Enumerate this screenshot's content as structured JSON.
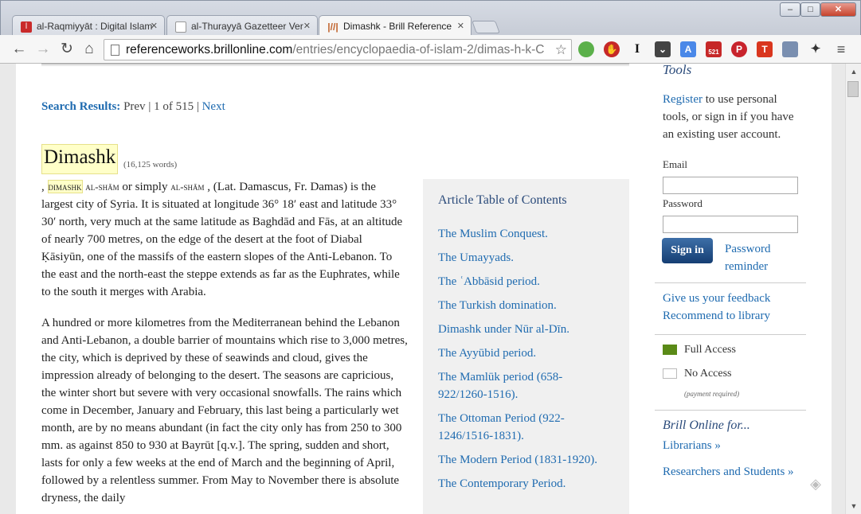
{
  "browser": {
    "tabs": [
      {
        "label": "al-Raqmiyyāt : Digital Islam",
        "icon": "al-raqmiyyat-icon"
      },
      {
        "label": "al-Thurayyā Gazetteer Ver",
        "icon": "page-icon"
      },
      {
        "label": "Dimashk - Brill Reference",
        "icon": "brill-icon"
      }
    ],
    "url_host": "referenceworks.brillonline.com",
    "url_path": "/entries/encyclopaedia-of-islam-2/dimas-h-k-C",
    "extensions": [
      "evernote-icon",
      "adblock-icon",
      "instapaper-icon",
      "pocket-icon",
      "translate-icon",
      "badge-521-icon",
      "pinterest-icon",
      "todoist-icon",
      "notes-icon",
      "puzzle-icon"
    ],
    "ext_badge": "521",
    "accent": "#1f6bb0"
  },
  "search": {
    "label": "Search Results:",
    "prev": "Prev",
    "position": "1 of 515",
    "next": "Next"
  },
  "article": {
    "title": "Dimashk",
    "word_count": "(16,125 words)",
    "headword": "dimashk",
    "alias1": "al-shām",
    "alias2": "al-shām",
    "intro_lead": ",",
    "para1_a": " or simply ",
    "para1_b": " , (Lat. Damascus, Fr. Damas) is the largest city of Syria. It is situated at longitude 36° 18′ east and latitude 33° 30′ north, very much at the same latitude as Baghdād and Fās, at an altitude of nearly 700 metres, on the edge of the desert at the foot of Diabal Ḳāsiyūn, one of the massifs of the eastern slopes of the Anti-Lebanon. To the east and the north-east the steppe extends as far as the Euphrates, while to the south it merges with Arabia.",
    "para2": "A hundred or more kilometres from the Mediterranean behind the Lebanon and Anti-Lebanon, a double barrier of mountains which rise to 3,000 metres, the city, which is deprived by these of seawinds and cloud, gives the impression already of belonging to the desert. The seasons are capricious, the winter short but severe with very occasional snowfalls. The rains which come in December, January and February, this last being a particularly wet month, are by no means abundant (in fact the city only has from 250 to 300 mm. as against 850 to 930 at Bayrūt [q.v.]. The spring, sudden and short, lasts for only a few weeks at the end of March and the beginning of April, followed by a relentless summer. From May to November there is absolute dryness, the daily"
  },
  "toc": {
    "title": "Article Table of Contents",
    "items": [
      "The Muslim Conquest.",
      "The Umayyads.",
      "The ʿAbbāsid period.",
      "The Turkish domination.",
      "Dimashk under Nūr al-Dīn.",
      "The Ayyūbid period.",
      "The Mamlūk period (658-922/1260-1516).",
      "The Ottoman Period (922-1246/1516-1831).",
      "The Modern Period (1831-1920).",
      "The Contemporary Period."
    ]
  },
  "sidebar": {
    "tools_title": "Tools",
    "register_link": "Register",
    "register_text": " to use personal tools, or sign in if you have an existing user account.",
    "email_label": "Email",
    "password_label": "Password",
    "signin_label": "Sign in",
    "password_reminder": "Password reminder",
    "feedback_link": "Give us your feedback",
    "recommend_link": "Recommend to library",
    "full_access": "Full Access",
    "no_access": "No Access",
    "payment_required": "(payment required)",
    "brill_online_title": "Brill Online for...",
    "librarians_link": "Librarians »",
    "researchers_link": "Researchers and Students »",
    "full_access_color": "#5a8a17"
  }
}
